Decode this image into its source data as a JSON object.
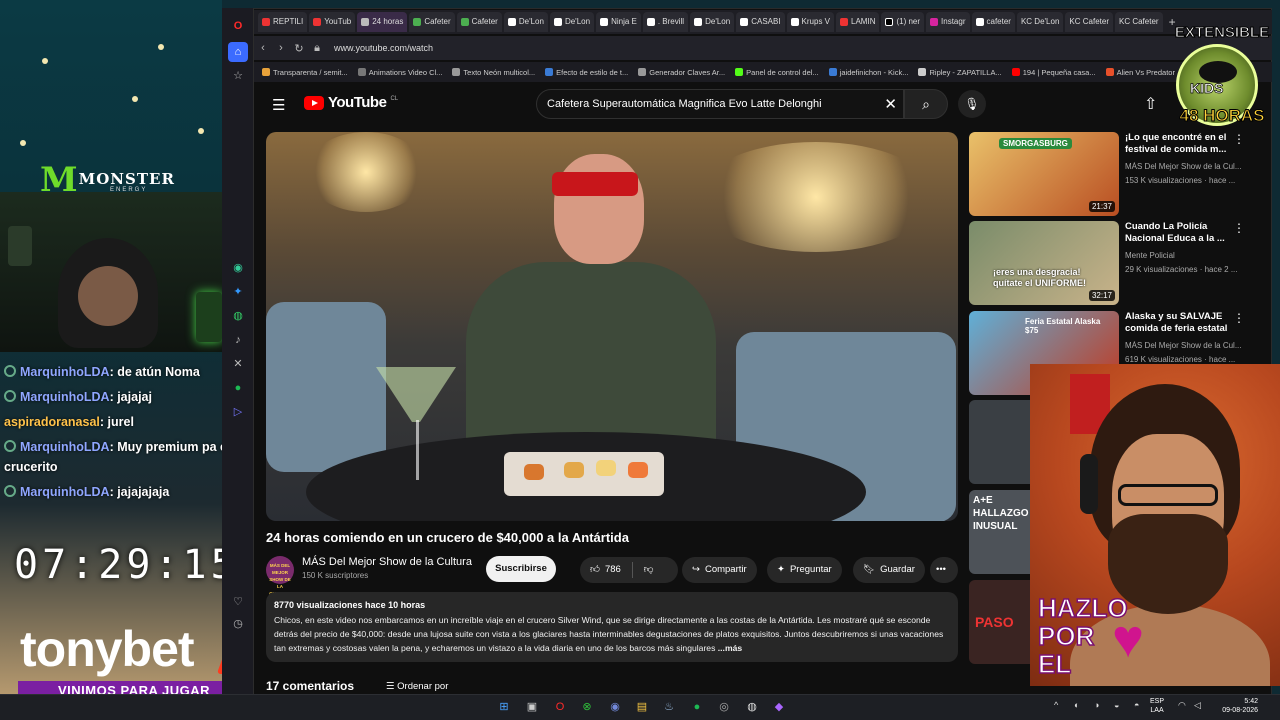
{
  "browser": {
    "tabs": [
      "REPTILI",
      "YouTub",
      "24 horas",
      "Cafeter",
      "Cafeter",
      "De'Lon",
      "De'Lon",
      "Ninja E",
      ". Brevill",
      "De'Lon",
      "CASABI",
      "Krups V",
      "LAMIN",
      "(1) ner",
      "Instagr",
      "cafeter",
      "KC De'Lon",
      "KC Cafeter",
      "KC Cafeter"
    ],
    "url": "www.youtube.com/watch",
    "bookmarks": [
      "Transparenta / semit...",
      "Animations Video Cl...",
      "Texto Neón multicol...",
      "Efecto de estilo de t...",
      "Generador Claves Ar...",
      "Panel de control del...",
      "jaidefinichon - Kick...",
      "Ripley - ZAPATILLA...",
      "194 | Pequeña casa...",
      "Alien Vs Predator"
    ]
  },
  "youtube": {
    "logo_text": "YouTube",
    "logo_country": "CL",
    "search_value": "Cafetera Superautomática Magnifica Evo Latte Delonghi",
    "video": {
      "title": "24 horas comiendo en un crucero de $40,000 a la Antártida",
      "channel": "MÁS Del Mejor Show de la Cultura",
      "avatar_text": "MÁS DEL MEJOR SHOW DE LA CULTURA",
      "subscribers": "150 K suscriptores",
      "subscribe_label": "Suscribirse",
      "likes": "786",
      "share_label": "Compartir",
      "ask_label": "Preguntar",
      "save_label": "Guardar",
      "more_label": "•••",
      "views_date": "8770 visualizaciones  hace 10 horas",
      "description": "Chicos, en este video nos embarcamos en un increíble viaje en el crucero Silver Wind, que se dirige directamente a las costas de la Antártida. Les mostraré qué se esconde detrás del precio de $40,000: desde una lujosa suite con vista a los glaciares hasta interminables degustaciones de platos exquisitos. Juntos descubriremos si unas vacaciones tan extremas y costosas valen la pena, y echaremos un vistazo a la vida diaria en uno de los barcos más singulares",
      "more_link": "...más",
      "comments_count": "17 comentarios",
      "sort_label": "Ordenar por"
    },
    "recommendations": [
      {
        "title": "¡Lo que encontré en el festival de comida m...",
        "channel": "MÁS Del Mejor Show de la Cul...",
        "meta": "153 K visualizaciones · hace ...",
        "duration": "21:37",
        "thumb_text": "SMORGASBURG",
        "colors": [
          "#e9c16a",
          "#b94e22"
        ]
      },
      {
        "title": "Cuando La Policía Nacional Educa a la ...",
        "channel": "Mente Policial",
        "meta": "29 K visualizaciones · hace 2 ...",
        "duration": "32:17",
        "thumb_text": "¡eres una desgracia! quítate el UNIFORME!",
        "colors": [
          "#7a8c6a",
          "#c9b38a"
        ]
      },
      {
        "title": "Alaska y su SALVAJE comida de feria estatal",
        "channel": "MÁS Del Mejor Show de la Cul...",
        "meta": "619 K visualizaciones · hace ...",
        "duration": "",
        "thumb_text": "Feria Estatal Alaska $75",
        "colors": [
          "#5fb0d8",
          "#c2381f"
        ]
      }
    ],
    "partial_thumbs": [
      "A+E HALLAZGO INUSUAL",
      "PASO"
    ]
  },
  "overlay": {
    "monster_logo": "MONSTER",
    "monster_sub": "ENERGY",
    "chat": [
      {
        "user": "MarquinhoLDA",
        "text": ": de atún Noma",
        "orange": false
      },
      {
        "user": "MarquinhoLDA",
        "text": ": jajajaj",
        "orange": false
      },
      {
        "user": "aspiradoranasal",
        "text": ": jurel",
        "orange": true
      },
      {
        "user": "MarquinhoLDA",
        "text": ": Muy premium pa ese crucerito",
        "orange": false
      },
      {
        "user": "MarquinhoLDA",
        "text": ": jajajajaja",
        "orange": false
      }
    ],
    "clock": "07:29:15",
    "sponsor": "tonybet",
    "slogan": "VINIMOS PARA JUGAR",
    "badge_top": "EXTENSIBLE",
    "badge_kids": "KIDS",
    "badge_hours": "48 HORAS",
    "hazlo": [
      "HAZLO",
      "POR",
      "EL"
    ]
  },
  "taskbar": {
    "lang": [
      "ESP",
      "LAA"
    ],
    "time": "5:42",
    "date": "09-08-2026"
  }
}
